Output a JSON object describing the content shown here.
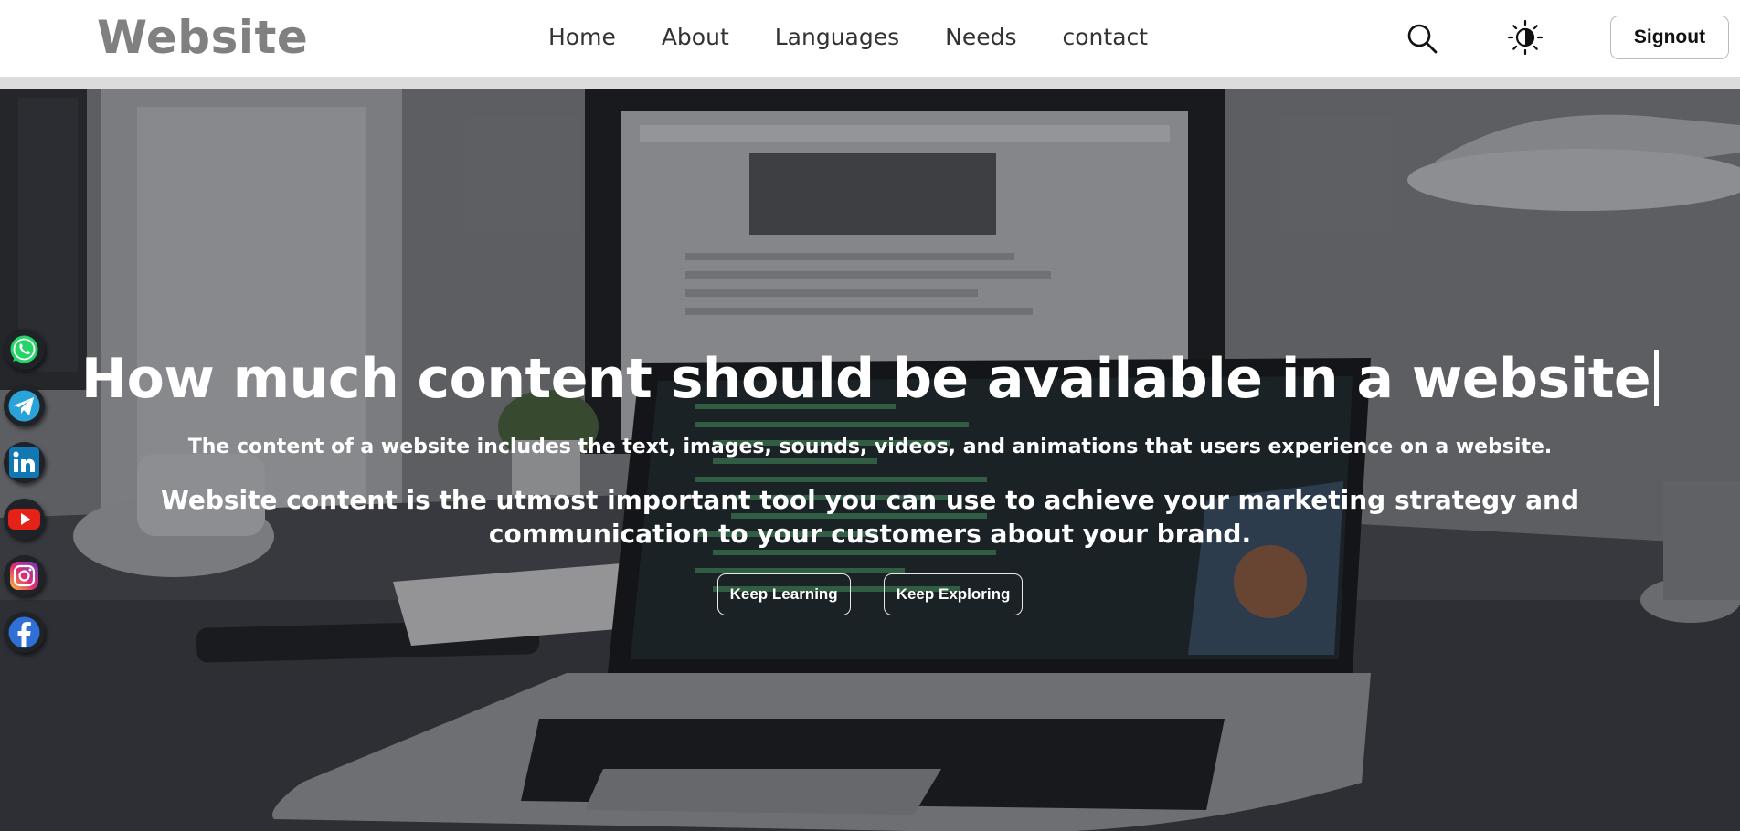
{
  "header": {
    "brand": "Website",
    "nav": [
      "Home",
      "About",
      "Languages",
      "Needs",
      "contact"
    ],
    "signout_label": "Signout"
  },
  "icons": {
    "search": "search-icon",
    "theme": "theme-toggle-icon"
  },
  "hero": {
    "title": "How much content should be available in a website",
    "subtitle": "The content of a website includes the text, images, sounds, videos, and animations that users experience on a website.",
    "body": "Website content is the utmost important tool you can use to achieve your marketing strategy and communication to your customers about your brand.",
    "buttons": [
      "Keep Learning",
      "Keep Exploring"
    ]
  },
  "social": [
    "whatsapp",
    "telegram",
    "linkedin",
    "youtube",
    "instagram",
    "facebook"
  ],
  "colors": {
    "brand_text": "#808080",
    "whatsapp": "#25d366",
    "telegram": "#2aa3db",
    "linkedin": "#1178b4",
    "youtube": "#e62117",
    "facebook": "#2f6fd6"
  }
}
